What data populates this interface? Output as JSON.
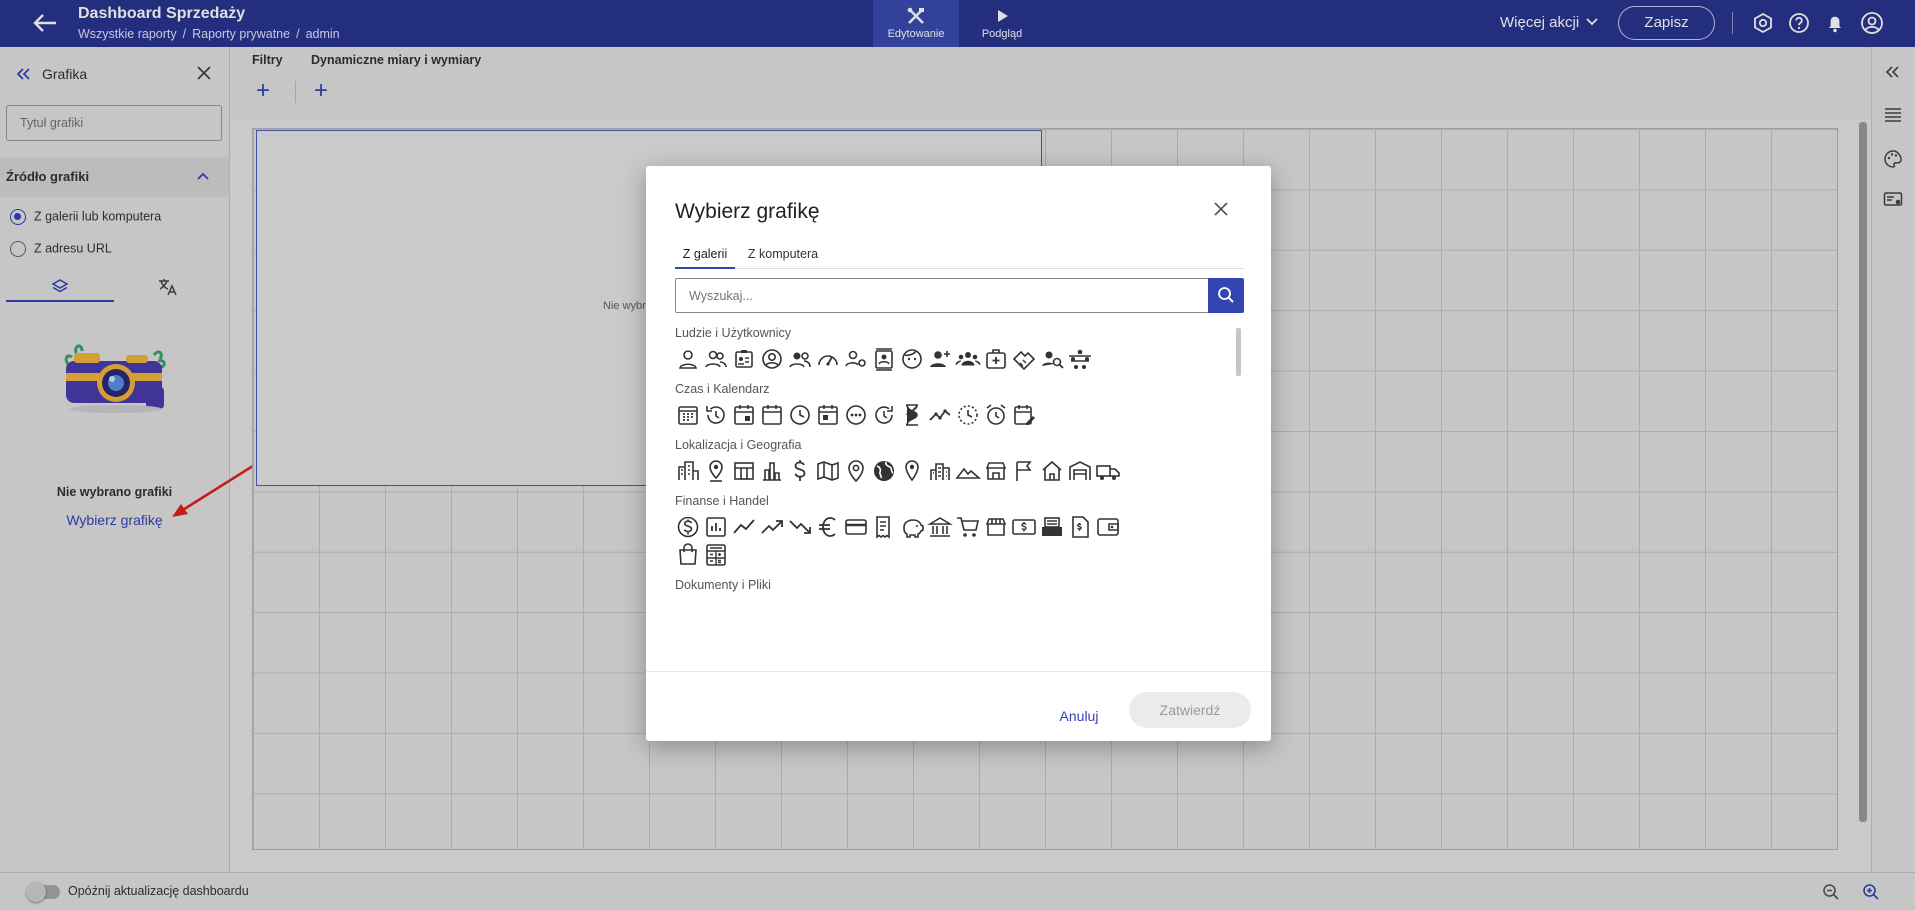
{
  "header": {
    "title": "Dashboard Sprzedaży",
    "breadcrumb": [
      "Wszystkie raporty",
      "Raporty prywatne",
      "admin"
    ],
    "breadcrumb_sep": "/",
    "mode_edit": "Edytowanie",
    "mode_preview": "Podgląd",
    "more_actions": "Więcej akcji",
    "save": "Zapisz",
    "icons": [
      "back-arrow-icon",
      "edit-tools-icon",
      "play-icon",
      "chevron-down-icon",
      "settings-icon",
      "help-icon",
      "bell-icon",
      "user-icon"
    ]
  },
  "left_panel": {
    "title": "Grafika",
    "title_placeholder": "Tytuł grafiki",
    "source_header": "Źródło grafiki",
    "options": [
      {
        "label": "Z galerii lub komputera",
        "checked": true
      },
      {
        "label": "Z adresu URL",
        "checked": false
      }
    ],
    "tab_icons": [
      "layers-icon",
      "translate-icon"
    ],
    "active_tab": 0,
    "empty_text": "Nie wybrano grafiki",
    "choose_link": "Wybierz grafikę"
  },
  "filters": {
    "filters_label": "Filtry",
    "dynamic_label": "Dynamiczne miary i wymiary",
    "add_symbol": "+"
  },
  "canvas": {
    "widget_text": "Nie wybra"
  },
  "bottom": {
    "delay_label": "Opóźnij aktualizację dashboardu",
    "delay_on": false
  },
  "modal": {
    "title": "Wybierz grafikę",
    "tabs": [
      "Z galerii",
      "Z komputera"
    ],
    "active_tab": 0,
    "search_placeholder": "Wyszukaj...",
    "categories": [
      {
        "name": "Ludzie i Użytkownicy",
        "icons": [
          "person-icon",
          "people-icon",
          "id-badge-icon",
          "account-circle-icon",
          "supervisor-icon",
          "gauge-icon",
          "person-gear-icon",
          "contact-card-icon",
          "face-icon",
          "person-add-icon",
          "groups-icon",
          "medical-case-icon",
          "handshake-icon",
          "person-search-icon",
          "network-icon"
        ]
      },
      {
        "name": "Czas i Kalendarz",
        "icons": [
          "calendar-month-icon",
          "history-icon",
          "calendar-event-icon",
          "calendar-icon",
          "clock-icon",
          "calendar-today-icon",
          "pending-icon",
          "update-icon",
          "hourglass-icon",
          "timeline-icon",
          "dotted-clock-icon",
          "alarm-icon",
          "calendar-edit-icon"
        ]
      },
      {
        "name": "Lokalizacja i Geografia",
        "icons": [
          "city-icon",
          "pin-icon",
          "table-view-icon",
          "bar-chart-icon",
          "dollar-icon",
          "map-icon",
          "location-icon",
          "globe-icon",
          "place-icon",
          "buildings-icon",
          "terrain-icon",
          "store-icon",
          "flag-icon",
          "home-icon",
          "warehouse-icon",
          "truck-icon"
        ]
      },
      {
        "name": "Finanse i Handel",
        "icons": [
          "dollar-circle-icon",
          "analytics-icon",
          "line-chart-icon",
          "trending-up-icon",
          "trending-down-icon",
          "euro-icon",
          "credit-card-icon",
          "receipt-icon",
          "piggy-bank-icon",
          "bank-icon",
          "cart-icon",
          "storefront-icon",
          "payments-icon",
          "cash-register-icon",
          "invoice-icon",
          "wallet-icon",
          "shopping-bag-icon",
          "calculator-icon"
        ]
      },
      {
        "name": "Dokumenty i Pliki",
        "icons": []
      }
    ],
    "cancel": "Anuluj",
    "confirm": "Zatwierdź",
    "confirm_enabled": false
  },
  "colors": {
    "header_bg": "#2a3590",
    "accent": "#3344b3",
    "annotation_arrow": "#e0201c"
  }
}
